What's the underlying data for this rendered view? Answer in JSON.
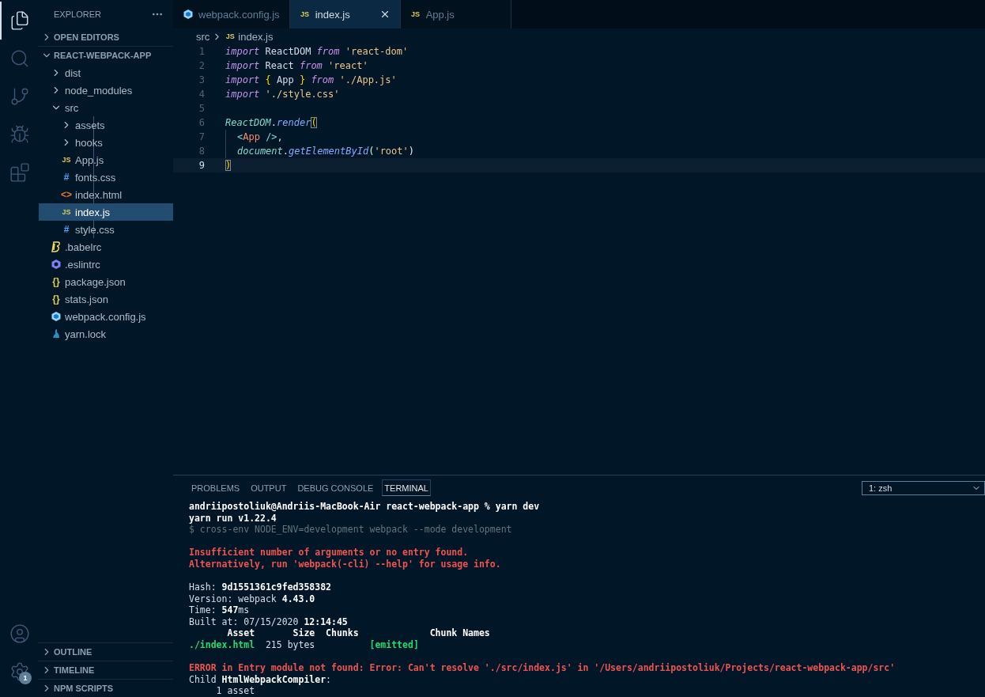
{
  "activity_bar": {
    "items": [
      {
        "kind": "files",
        "selected": true
      },
      {
        "kind": "search",
        "selected": false
      },
      {
        "kind": "source-control",
        "selected": false
      },
      {
        "kind": "debug",
        "selected": false
      },
      {
        "kind": "extensions",
        "selected": false
      }
    ],
    "bottom": [
      {
        "kind": "account"
      },
      {
        "kind": "settings",
        "badge": "1"
      }
    ]
  },
  "sidebar": {
    "title": "EXPLORER",
    "sections": [
      {
        "title": "OPEN EDITORS",
        "expanded": false
      },
      {
        "title": "REACT-WEBPACK-APP",
        "expanded": true,
        "children": [
          {
            "name": "dist",
            "kind": "folder",
            "expanded": false,
            "selected": false
          },
          {
            "name": "node_modules",
            "kind": "folder",
            "expanded": false,
            "selected": false
          },
          {
            "name": "src",
            "kind": "folder",
            "expanded": true,
            "selected": false,
            "children": [
              {
                "name": "assets",
                "kind": "folder",
                "expanded": false,
                "selected": false
              },
              {
                "name": "hooks",
                "kind": "folder",
                "expanded": false,
                "selected": false
              },
              {
                "name": "App.js",
                "kind": "js",
                "icon_label": "JS",
                "selected": false
              },
              {
                "name": "fonts.css",
                "kind": "css",
                "icon_label": "#",
                "selected": false
              },
              {
                "name": "index.html",
                "kind": "html",
                "icon_label": "<>",
                "selected": false
              },
              {
                "name": "index.js",
                "kind": "js",
                "icon_label": "JS",
                "selected": true
              },
              {
                "name": "style.css",
                "kind": "css",
                "icon_label": "#",
                "selected": false
              }
            ]
          },
          {
            "name": ".babelrc",
            "kind": "babel",
            "selected": false
          },
          {
            "name": ".eslintrc",
            "kind": "eslint",
            "selected": false
          },
          {
            "name": "package.json",
            "kind": "json",
            "icon_label": "{}",
            "selected": false
          },
          {
            "name": "stats.json",
            "kind": "json",
            "icon_label": "{}",
            "selected": false
          },
          {
            "name": "webpack.config.js",
            "kind": "webpack",
            "selected": false
          },
          {
            "name": "yarn.lock",
            "kind": "yarn",
            "selected": false
          }
        ]
      }
    ],
    "bottom_sections": [
      {
        "title": "OUTLINE",
        "expanded": false
      },
      {
        "title": "TIMELINE",
        "expanded": false
      },
      {
        "title": "NPM SCRIPTS",
        "expanded": false
      }
    ]
  },
  "tabs": [
    {
      "label": "webpack.config.js",
      "kind": "webpack",
      "selected": false
    },
    {
      "label": "index.js",
      "kind": "js",
      "icon_label": "JS",
      "selected": true
    },
    {
      "label": "App.js",
      "kind": "js",
      "icon_label": "JS",
      "selected": false
    }
  ],
  "breadcrumb": {
    "folder": "src",
    "file": "index.js",
    "kind": "js",
    "icon_label": "JS"
  },
  "code": [
    {
      "number": "1",
      "current": false,
      "indent": false,
      "tokens": [
        {
          "kind": "keyword",
          "text": "import"
        },
        {
          "kind": "ident",
          "text": " ReactDOM "
        },
        {
          "kind": "keyword",
          "text": "from"
        },
        {
          "kind": "string",
          "text": " 'react-dom'"
        }
      ]
    },
    {
      "number": "2",
      "current": false,
      "indent": false,
      "tokens": [
        {
          "kind": "keyword",
          "text": "import"
        },
        {
          "kind": "ident",
          "text": " React "
        },
        {
          "kind": "keyword",
          "text": "from"
        },
        {
          "kind": "string",
          "text": " 'react'"
        }
      ]
    },
    {
      "number": "3",
      "current": false,
      "indent": false,
      "tokens": [
        {
          "kind": "keyword",
          "text": "import"
        },
        {
          "kind": "brace",
          "text": " {"
        },
        {
          "kind": "ident",
          "text": " App "
        },
        {
          "kind": "brace",
          "text": "} "
        },
        {
          "kind": "keyword",
          "text": "from"
        },
        {
          "kind": "string",
          "text": " './App.js'"
        }
      ]
    },
    {
      "number": "4",
      "current": false,
      "indent": false,
      "tokens": [
        {
          "kind": "keyword",
          "text": "import"
        },
        {
          "kind": "string",
          "text": " './style.css'"
        }
      ]
    },
    {
      "number": "5",
      "current": false,
      "indent": false
    },
    {
      "number": "6",
      "current": false,
      "indent": false,
      "tokens": [
        {
          "kind": "object",
          "text": "ReactDOM"
        },
        {
          "kind": "punct",
          "text": "."
        },
        {
          "kind": "function",
          "text": "render"
        },
        {
          "kind": "bracket-match",
          "text": "("
        }
      ]
    },
    {
      "number": "7",
      "current": false,
      "indent": true,
      "tokens": [
        {
          "kind": "tag-punct",
          "text": "<"
        },
        {
          "kind": "tag",
          "text": "App"
        },
        {
          "kind": "tag-punct",
          "text": " />"
        },
        {
          "kind": "punct",
          "text": ","
        }
      ]
    },
    {
      "number": "8",
      "current": false,
      "indent": true,
      "tokens": [
        {
          "kind": "object",
          "text": "document"
        },
        {
          "kind": "punct",
          "text": "."
        },
        {
          "kind": "function",
          "text": "getElementById"
        },
        {
          "kind": "paren",
          "text": "("
        },
        {
          "kind": "string",
          "text": "'root'"
        },
        {
          "kind": "paren",
          "text": ")"
        }
      ]
    },
    {
      "number": "9",
      "current": true,
      "indent": false,
      "tokens": [
        {
          "kind": "bracket-match",
          "text": ")"
        }
      ]
    }
  ],
  "panel": {
    "tabs": [
      {
        "label": "PROBLEMS",
        "selected": false
      },
      {
        "label": "OUTPUT",
        "selected": false
      },
      {
        "label": "DEBUG CONSOLE",
        "selected": false
      },
      {
        "label": "TERMINAL",
        "selected": true
      }
    ],
    "terminal_select": "1: zsh",
    "lines": [
      {
        "kind": "text",
        "segments": [
          {
            "kind": "bold",
            "text": "andriipostoliuk@Andriis-MacBook-Air react-webpack-app % yarn dev"
          }
        ]
      },
      {
        "kind": "text",
        "segments": [
          {
            "kind": "bold",
            "text": "yarn run v1.22.4"
          }
        ]
      },
      {
        "kind": "text",
        "segments": [
          {
            "kind": "dim",
            "text": "$ cross-env NODE_ENV=development webpack --mode development"
          }
        ]
      },
      {
        "kind": "blank"
      },
      {
        "kind": "text",
        "segments": [
          {
            "kind": "error",
            "text": "Insufficient number of arguments or no entry found."
          }
        ]
      },
      {
        "kind": "text",
        "segments": [
          {
            "kind": "error",
            "text": "Alternatively, run 'webpack(-cli) --help' for usage info."
          }
        ]
      },
      {
        "kind": "blank"
      },
      {
        "kind": "text",
        "segments": [
          {
            "kind": "plain",
            "text": "Hash: "
          },
          {
            "kind": "bold",
            "text": "9d1551361c9fed358382"
          }
        ]
      },
      {
        "kind": "text",
        "segments": [
          {
            "kind": "plain",
            "text": "Version: webpack "
          },
          {
            "kind": "bold",
            "text": "4.43.0"
          }
        ]
      },
      {
        "kind": "text",
        "segments": [
          {
            "kind": "plain",
            "text": "Time: "
          },
          {
            "kind": "bold",
            "text": "547"
          },
          {
            "kind": "plain",
            "text": "ms"
          }
        ]
      },
      {
        "kind": "text",
        "segments": [
          {
            "kind": "plain",
            "text": "Built at: 07/15/2020 "
          },
          {
            "kind": "bold",
            "text": "12:14:45"
          }
        ]
      },
      {
        "kind": "text",
        "segments": [
          {
            "kind": "bold",
            "text": "       Asset       Size  Chunks             Chunk Names"
          }
        ]
      },
      {
        "kind": "text",
        "segments": [
          {
            "kind": "success",
            "text": "./index.html"
          },
          {
            "kind": "plain",
            "text": "  215 bytes          "
          },
          {
            "kind": "success",
            "text": "[emitted]"
          }
        ]
      },
      {
        "kind": "blank"
      },
      {
        "kind": "text",
        "segments": [
          {
            "kind": "error",
            "text": "ERROR in Entry module not found: Error: Can't resolve './src/index.js' in '/Users/andriipostoliuk/Projects/react-webpack-app/src'"
          }
        ]
      },
      {
        "kind": "text",
        "segments": [
          {
            "kind": "plain",
            "text": "Child "
          },
          {
            "kind": "bold",
            "text": "HtmlWebpackCompiler"
          },
          {
            "kind": "plain",
            "text": ":"
          }
        ]
      },
      {
        "kind": "text",
        "segments": [
          {
            "kind": "plain",
            "text": "     1 asset"
          }
        ]
      }
    ]
  }
}
